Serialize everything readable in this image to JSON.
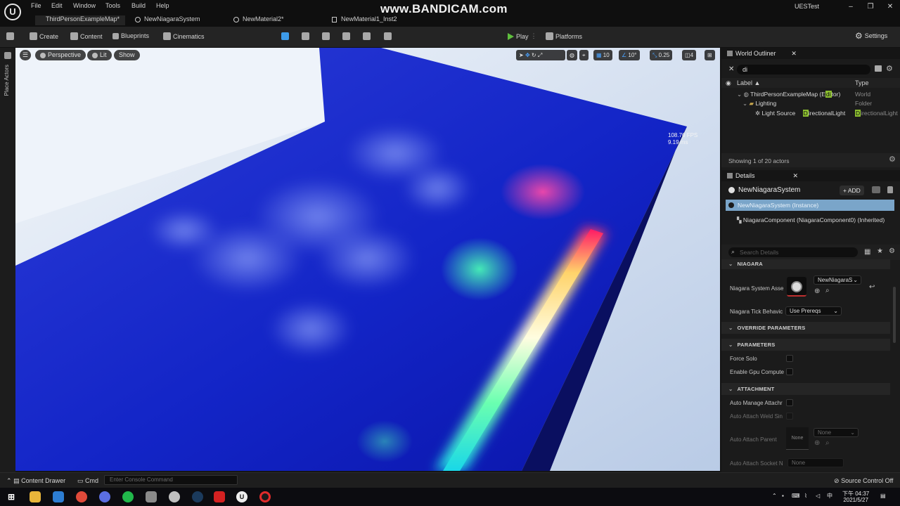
{
  "app": {
    "menu": [
      "File",
      "Edit",
      "Window",
      "Tools",
      "Build",
      "Help"
    ],
    "tabs": [
      "ThirdPersonExampleMap*",
      "NewNiagaraSystem",
      "NewMaterial2*",
      "NewMaterial1_Inst2"
    ],
    "watermark": "www.BANDICAM.com",
    "project": "UESTest",
    "window_buttons": [
      "–",
      "❐",
      "✕"
    ]
  },
  "toolbar": {
    "create": "Create",
    "content": "Content",
    "blueprints": "Blueprints",
    "cinematics": "Cinematics",
    "play": "Play",
    "platforms": "Platforms",
    "settings": "Settings"
  },
  "left_strip": {
    "label": "Place Actors"
  },
  "viewport": {
    "perspective": "Perspective",
    "lit": "Lit",
    "show": "Show",
    "grid_snap": "10",
    "rotation_snap": "10°",
    "scale_snap": "0.25",
    "camera_speed": "4",
    "fps": "108.76 FPS",
    "ms": "9.19 ms"
  },
  "outliner": {
    "tab": "World Outliner",
    "search_value": "di",
    "col_label": "Label",
    "col_type": "Type",
    "rows": [
      {
        "pre": "ThirdPersonExampleMap (E",
        "hl": "di",
        "post": "tor)",
        "type": "World"
      },
      {
        "pre": "Lighting",
        "hl": "",
        "post": "",
        "type": "Folder"
      },
      {
        "pre": "Light Source",
        "hl": "",
        "post": "",
        "type": ""
      }
    ],
    "light_source_type_pre": "",
    "light_source_hl": "D",
    "light_source_post": "irectionalLight",
    "light_source_col2_hl": "D",
    "light_source_col2_post": "irectionalLight",
    "status": "Showing 1 of 20 actors"
  },
  "details": {
    "tab": "Details",
    "title": "NewNiagaraSystem",
    "add": "ADD",
    "instance": "NewNiagaraSystem (Instance)",
    "component": "NiagaraComponent (NiagaraComponent0) (Inherited)",
    "search_placeholder": "Search Details",
    "cat_niagara": "NIAGARA",
    "prop_asset": "Niagara System Asse",
    "asset_value": "NewNiagaraS",
    "prop_tick": "Niagara Tick Behavic",
    "tick_value": "Use Prereqs",
    "cat_override": "OVERRIDE PARAMETERS",
    "cat_parameters": "PARAMETERS",
    "prop_force_solo": "Force Solo",
    "prop_gpu": "Enable Gpu Compute",
    "cat_attachment": "ATTACHMENT",
    "prop_auto_manage": "Auto Manage Attachr",
    "prop_weld": "Auto Attach Weld Sin",
    "prop_parent": "Auto Attach Parent",
    "parent_thumb": "None",
    "parent_dropdown": "None",
    "prop_socket": "Auto Attach Socket N",
    "socket_value": "None"
  },
  "bottom": {
    "content_drawer": "Content Drawer",
    "cmd": "Cmd",
    "console_placeholder": "Enter Console Command",
    "source_control": "Source Control Off"
  },
  "taskbar": {
    "time": "下午 04:37",
    "date": "2021/5/27"
  },
  "colors": {
    "accent_green": "#8cbf2f",
    "selection_blue": "#7aa5c9",
    "play_green": "#5fbf3e"
  }
}
